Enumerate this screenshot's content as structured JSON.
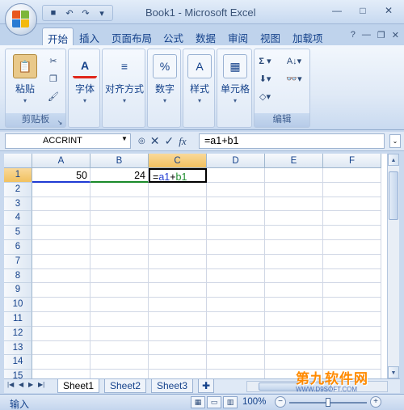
{
  "window": {
    "title": "Book1 - Microsoft Excel"
  },
  "qat": {
    "icons": [
      "save-icon",
      "undo-icon",
      "redo-icon",
      "customize-icon"
    ]
  },
  "ribbon": {
    "tabs": [
      "开始",
      "插入",
      "页面布局",
      "公式",
      "数据",
      "审阅",
      "视图",
      "加载项"
    ],
    "active_tab": "开始",
    "groups": {
      "clipboard": {
        "label": "剪贴板",
        "paste_label": "粘贴"
      },
      "font": {
        "label": "字体"
      },
      "alignment": {
        "label": "对齐方式"
      },
      "number": {
        "label": "数字"
      },
      "styles": {
        "label": "样式"
      },
      "cells": {
        "label": "单元格"
      },
      "editing": {
        "label": "编辑"
      }
    }
  },
  "formula_bar": {
    "name_box": "ACCRINT",
    "formula": "=a1+b1"
  },
  "grid": {
    "columns": [
      "A",
      "B",
      "C",
      "D",
      "E",
      "F"
    ],
    "selected_column": "C",
    "rows": [
      "1",
      "2",
      "3",
      "4",
      "5",
      "6",
      "7",
      "8",
      "9",
      "10",
      "11",
      "12",
      "13",
      "14",
      "15"
    ],
    "selected_row": "1",
    "cells": {
      "A1": "50",
      "B1": "24",
      "C1": "=a1+b1"
    }
  },
  "sheets": {
    "tabs": [
      "Sheet1",
      "Sheet2",
      "Sheet3"
    ],
    "active": "Sheet1"
  },
  "status": {
    "mode": "输入",
    "zoom": "100%"
  },
  "watermark": {
    "main": "第九软件网",
    "url": "WWW.D9SOFT.COM"
  }
}
